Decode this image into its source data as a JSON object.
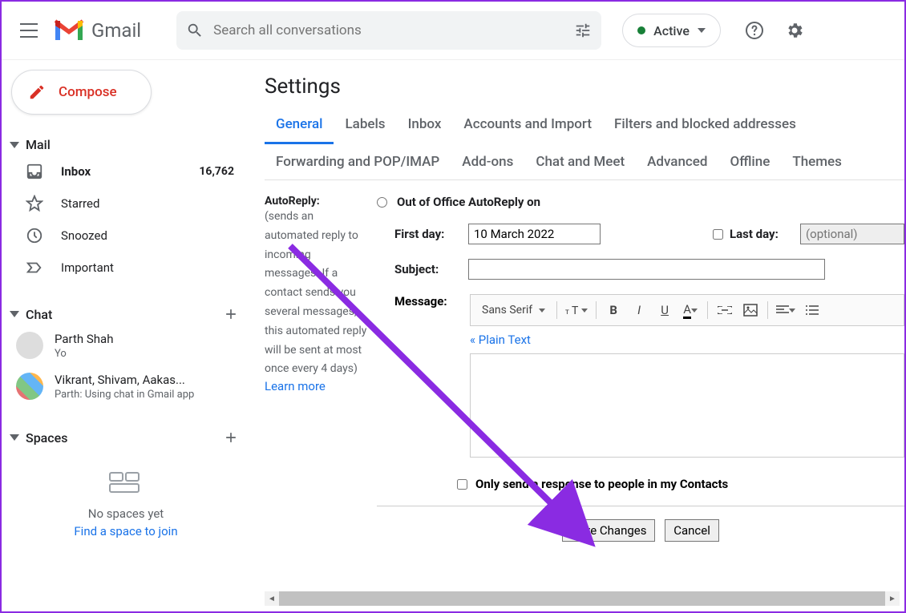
{
  "header": {
    "app_name": "Gmail",
    "search_placeholder": "Search all conversations",
    "status_label": "Active"
  },
  "sidebar": {
    "compose_label": "Compose",
    "sections": {
      "mail": "Mail",
      "chat": "Chat",
      "spaces": "Spaces"
    },
    "mail_items": [
      {
        "label": "Inbox",
        "count": "16,762",
        "bold": true
      },
      {
        "label": "Starred"
      },
      {
        "label": "Snoozed"
      },
      {
        "label": "Important"
      }
    ],
    "chat_items": [
      {
        "name": "Parth Shah",
        "preview": "Yo"
      },
      {
        "name": "Vikrant, Shivam, Aakas...",
        "preview": "Parth: Using chat in Gmail app"
      }
    ],
    "spaces_empty": {
      "title": "No spaces yet",
      "link": "Find a space to join"
    }
  },
  "settings": {
    "page_title": "Settings",
    "tabs": [
      "General",
      "Labels",
      "Inbox",
      "Accounts and Import",
      "Filters and blocked addresses",
      "Forwarding and POP/IMAP",
      "Add-ons",
      "Chat and Meet",
      "Advanced",
      "Offline",
      "Themes"
    ],
    "active_tab": "General",
    "autoreply": {
      "title": "AutoReply:",
      "desc": "(sends an automated reply to incoming messages. If a contact sends you several messages, this automated reply will be sent at most once every 4 days)",
      "learn": "Learn more",
      "radio_label": "Out of Office AutoReply on",
      "first_day_label": "First day:",
      "first_day_value": "10 March 2022",
      "last_day_label": "Last day:",
      "last_day_placeholder": "(optional)",
      "subject_label": "Subject:",
      "message_label": "Message:",
      "font_label": "Sans Serif",
      "plain_text": "« Plain Text",
      "contacts_label": "Only send a response to people in my Contacts",
      "save_btn": "Save Changes",
      "cancel_btn": "Cancel"
    }
  }
}
